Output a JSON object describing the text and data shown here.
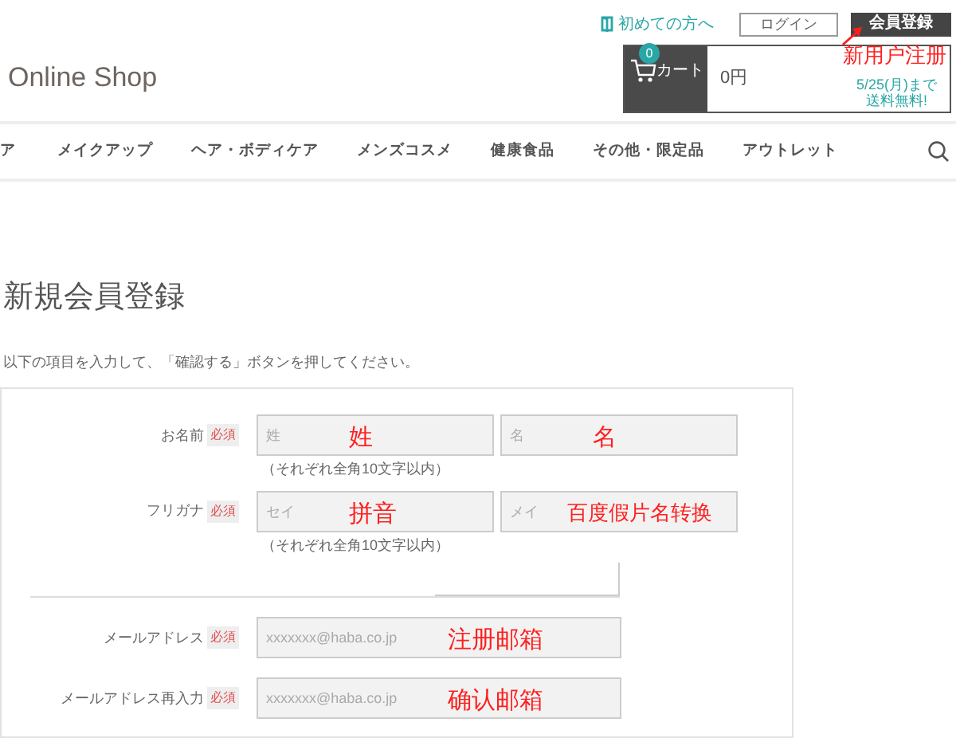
{
  "header": {
    "guide_link": "初めての方へ",
    "login_button": "ログイン",
    "register_button": "会員登録",
    "register_annotation": "新用户注册",
    "logo": "Online Shop",
    "cart": {
      "label": "カート",
      "count": "0",
      "total": "0円",
      "shipping_date": "5/25(月)まで",
      "shipping_note": "送料無料!"
    }
  },
  "nav": {
    "items": [
      "ア",
      "メイクアップ",
      "ヘア・ボディケア",
      "メンズコスメ",
      "健康食品",
      "その他・限定品",
      "アウトレット"
    ]
  },
  "page_title": "新規会員登録",
  "intro": "以下の項目を入力して、「確認する」ボタンを押してください。",
  "form": {
    "rows": [
      {
        "kind": "pair",
        "label": "お名前",
        "required": "必須",
        "fields": [
          {
            "placeholder": "姓",
            "annotation": "姓"
          },
          {
            "placeholder": "名",
            "annotation": "名"
          }
        ],
        "hint": "（それぞれ全角10文字以内）"
      },
      {
        "kind": "pair",
        "label": "フリガナ",
        "required": "必須",
        "fields": [
          {
            "placeholder": "セイ",
            "annotation": "拼音"
          },
          {
            "placeholder": "メイ",
            "annotation": "百度假片名转换"
          }
        ],
        "hint": "（それぞれ全角10文字以内）"
      },
      {
        "kind": "blank"
      },
      {
        "kind": "single",
        "label": "メールアドレス",
        "required": "必須",
        "fields": [
          {
            "placeholder": "xxxxxxx@haba.co.jp",
            "annotation": "注册邮箱"
          }
        ]
      },
      {
        "kind": "single",
        "label": "メールアドレス再入力",
        "required": "必須",
        "fields": [
          {
            "placeholder": "xxxxxxx@haba.co.jp",
            "annotation": "确认邮箱"
          }
        ]
      }
    ]
  }
}
